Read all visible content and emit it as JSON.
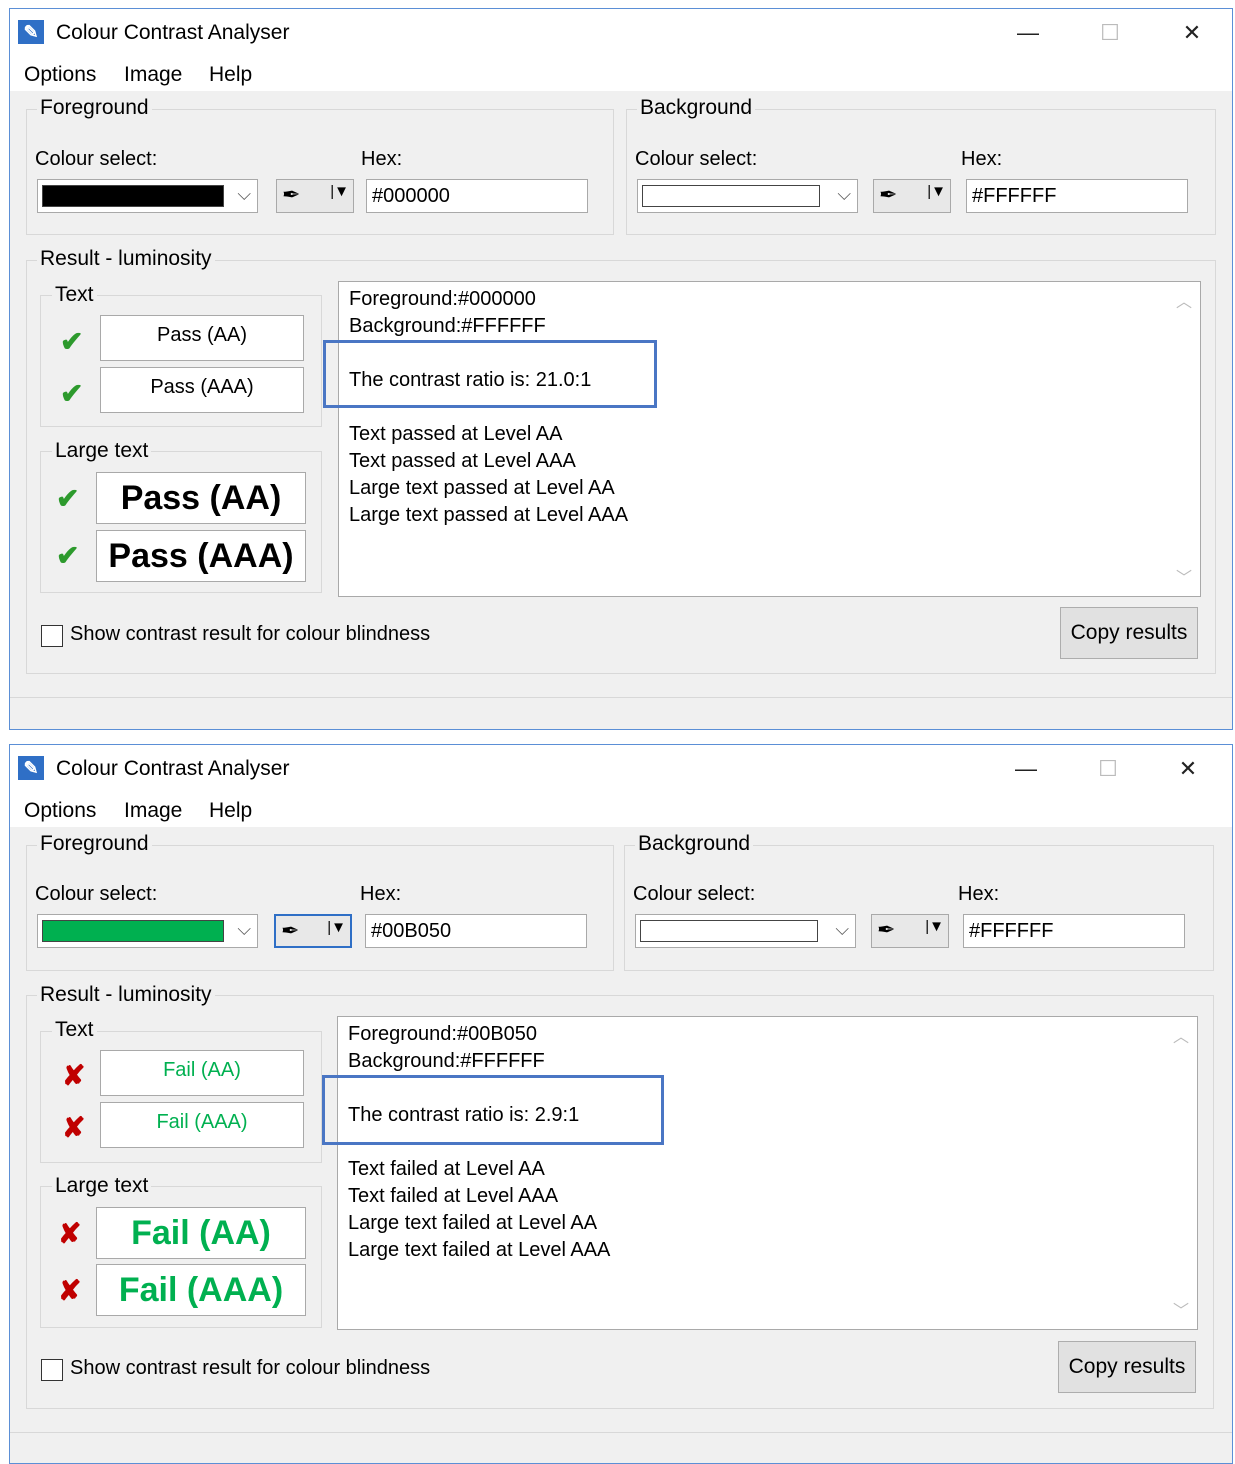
{
  "windows": [
    {
      "title": "Colour Contrast Analyser",
      "menu": [
        "Options",
        "Image",
        "Help"
      ],
      "foreground": {
        "group_label": "Foreground",
        "colour_select_label": "Colour select:",
        "hex_label": "Hex:",
        "hex_value": "#000000",
        "swatch_color": "#000000"
      },
      "background": {
        "group_label": "Background",
        "colour_select_label": "Colour select:",
        "hex_label": "Hex:",
        "hex_value": "#FFFFFF",
        "swatch_color": "#FFFFFF"
      },
      "result_label": "Result - luminosity",
      "text_group_label": "Text",
      "large_text_group_label": "Large text",
      "text_results": [
        "Pass (AA)",
        "Pass (AAA)"
      ],
      "large_results": [
        "Pass (AA)",
        "Pass (AAA)"
      ],
      "status": "pass",
      "details": {
        "fg_line": "Foreground:#000000",
        "bg_line": "Background:#FFFFFF",
        "ratio_line": "The contrast ratio is: 21.0:1",
        "lines": [
          "Text passed at Level AA",
          "Text passed at Level AAA",
          "Large text passed at Level AA",
          "Large text passed at Level AAA"
        ]
      },
      "colour_blindness_label": "Show contrast result for colour blindness",
      "copy_button": "Copy results"
    },
    {
      "title": "Colour Contrast Analyser",
      "menu": [
        "Options",
        "Image",
        "Help"
      ],
      "foreground": {
        "group_label": "Foreground",
        "colour_select_label": "Colour select:",
        "hex_label": "Hex:",
        "hex_value": "#00B050",
        "swatch_color": "#00B050"
      },
      "background": {
        "group_label": "Background",
        "colour_select_label": "Colour select:",
        "hex_label": "Hex:",
        "hex_value": "#FFFFFF",
        "swatch_color": "#FFFFFF"
      },
      "result_label": "Result - luminosity",
      "text_group_label": "Text",
      "large_text_group_label": "Large text",
      "text_results": [
        "Fail (AA)",
        "Fail (AAA)"
      ],
      "large_results": [
        "Fail (AA)",
        "Fail (AAA)"
      ],
      "status": "fail",
      "details": {
        "fg_line": "Foreground:#00B050",
        "bg_line": "Background:#FFFFFF",
        "ratio_line": "The contrast ratio is: 2.9:1",
        "lines": [
          "Text failed at Level AA",
          "Text failed at Level AAA",
          "Large text failed at Level AA",
          "Large text failed at Level AAA"
        ]
      },
      "colour_blindness_label": "Show contrast result for colour blindness",
      "copy_button": "Copy results"
    }
  ],
  "icons": {
    "minimize": "minimize-icon",
    "maximize": "maximize-icon",
    "close": "close-icon",
    "eyedropper": "eyedropper-icon",
    "check": "check-icon",
    "cross": "cross-icon"
  },
  "colors": {
    "pass_mark": "#2d9a2d",
    "fail_mark": "#c00000",
    "fail_text": "#00b050",
    "highlight": "#4a76c4"
  }
}
